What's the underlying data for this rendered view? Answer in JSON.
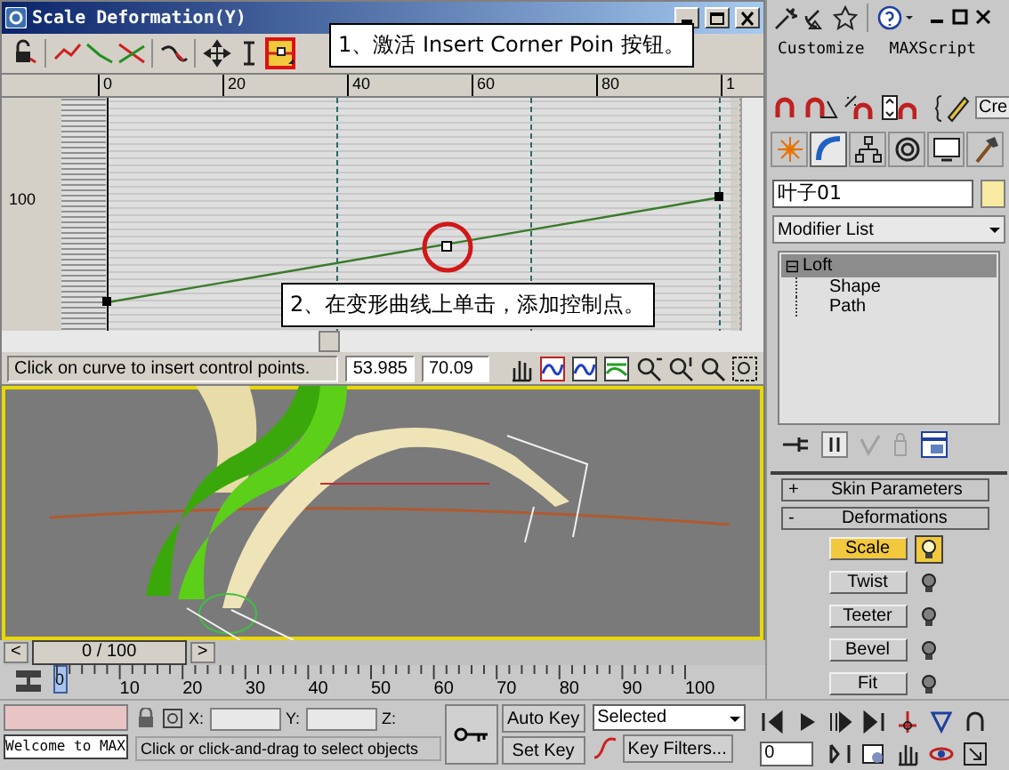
{
  "dialog": {
    "title": "Scale Deformation(Y)",
    "tools": [
      {
        "kind": "lock",
        "selected": false
      },
      {
        "kind": "red_curve",
        "selected": false
      },
      {
        "kind": "green_curve",
        "selected": false
      },
      {
        "kind": "cross_curve",
        "selected": false
      },
      {
        "kind": "swap_curve",
        "selected": false
      },
      {
        "kind": "move",
        "selected": false
      },
      {
        "kind": "vscale",
        "selected": false
      },
      {
        "kind": "insert",
        "selected": true
      }
    ],
    "ruler": [
      "0",
      "20",
      "40",
      "60",
      "80",
      "1"
    ],
    "value_label": "100",
    "callouts": [
      {
        "text": "1、激活 Insert Corner Poin 按钮。"
      },
      {
        "text": "2、在变形曲线上单击，添加控制点。"
      }
    ],
    "status": "Click on curve to insert control points.",
    "fields": [
      "53.985",
      "70.09"
    ]
  },
  "time_slider": {
    "prev": "<",
    "position": "0 / 100",
    "next": ">",
    "level": 0
  },
  "trackbar": [
    "0",
    "10",
    "20",
    "30",
    "40",
    "50",
    "60",
    "70",
    "80",
    "90",
    "100"
  ],
  "panel": {
    "menu": [
      "Customize",
      "MAXScript"
    ],
    "toolbar_field": "Cre",
    "tabs": [
      {
        "kind": "create",
        "selected": false
      },
      {
        "kind": "modify",
        "selected": true
      },
      {
        "kind": "hierarchy",
        "selected": false
      },
      {
        "kind": "motion",
        "selected": false
      },
      {
        "kind": "display",
        "selected": false
      },
      {
        "kind": "utilities",
        "selected": false
      }
    ],
    "object_name": "叶子01",
    "modifier_list": "Modifier List",
    "stack": [
      {
        "sign": "⊟",
        "label": "Loft",
        "selected": true,
        "children": [
          {
            "label": "Shape",
            "selected": false
          },
          {
            "label": "Path",
            "selected": false
          }
        ]
      }
    ],
    "rollouts": [
      {
        "sign": "+",
        "title": "Skin Parameters"
      },
      {
        "sign": "-",
        "title": "Deformations"
      }
    ],
    "deformations": [
      {
        "label": "Scale",
        "selected": true,
        "on": true
      },
      {
        "label": "Twist",
        "selected": false,
        "on": false
      },
      {
        "label": "Teeter",
        "selected": false,
        "on": false
      },
      {
        "label": "Bevel",
        "selected": false,
        "on": false
      },
      {
        "label": "Fit",
        "selected": false,
        "on": false
      }
    ]
  },
  "status_bar": {
    "welcome": "Welcome to MAX",
    "coords": [
      "X:",
      "Y:",
      "Z:"
    ],
    "prompt": "Click or click-and-drag to select objects",
    "auto_key": "Auto Key",
    "set_key": "Set Key",
    "key_mode": "Selected",
    "key_filters": "Key Filters...",
    "frame": "0"
  }
}
